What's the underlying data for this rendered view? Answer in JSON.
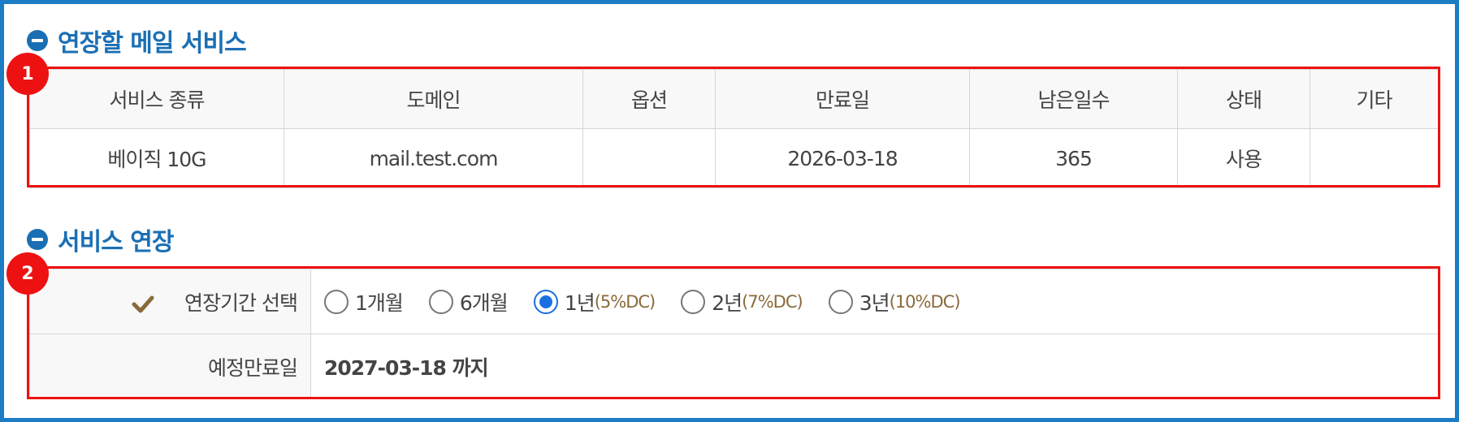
{
  "sections": {
    "current": {
      "title": "연장할 메일 서비스",
      "badge": "1"
    },
    "extend": {
      "title": "서비스 연장",
      "badge": "2"
    }
  },
  "current_table": {
    "headers": [
      "서비스 종류",
      "도메인",
      "옵션",
      "만료일",
      "남은일수",
      "상태",
      "기타"
    ],
    "row": [
      "베이직 10G",
      "mail.test.com",
      "",
      "2026-03-18",
      "365",
      "사용",
      ""
    ]
  },
  "extend_table": {
    "period_label": "연장기간 선택",
    "options": [
      {
        "label": "1개월",
        "dc": "",
        "checked": false
      },
      {
        "label": "6개월",
        "dc": "",
        "checked": false
      },
      {
        "label": "1년",
        "dc": "(5%DC)",
        "checked": true
      },
      {
        "label": "2년",
        "dc": "(7%DC)",
        "checked": false
      },
      {
        "label": "3년",
        "dc": "(10%DC)",
        "checked": false
      }
    ],
    "expiry_label": "예정만료일",
    "expiry_value": "2027-03-18 까지"
  },
  "colors": {
    "frame": "#1c7cc4",
    "title": "#1a6fb4",
    "highlight": "#ee1111",
    "radio_checked": "#1a6fe0",
    "discount": "#8a6a3a"
  }
}
